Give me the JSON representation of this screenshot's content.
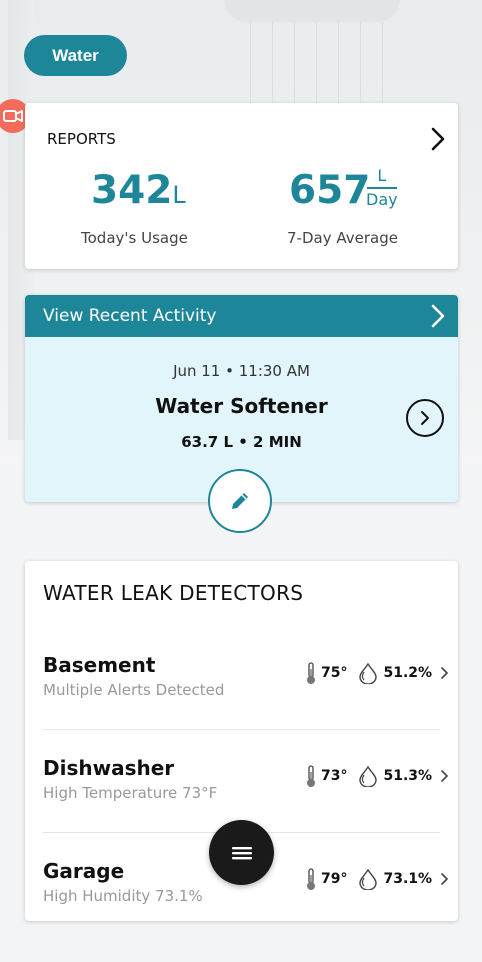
{
  "header": {
    "category_label": "Water"
  },
  "reports": {
    "title": "REPORTS",
    "today_value": "342",
    "today_unit": "L",
    "today_label": "Today's Usage",
    "avg_value": "657",
    "avg_unit_top": "L",
    "avg_unit_bottom": "Day",
    "avg_label": "7-Day Average"
  },
  "activity": {
    "header_label": "View Recent Activity",
    "date": "Jun 11 • 11:30 AM",
    "device": "Water Softener",
    "detail": "63.7 L • 2 MIN"
  },
  "leak_detectors": {
    "title": "WATER LEAK DETECTORS",
    "items": [
      {
        "name": "Basement",
        "status": "Multiple Alerts Detected",
        "temperature": "75°",
        "humidity": "51.2%"
      },
      {
        "name": "Dishwasher",
        "status": "High Temperature 73°F",
        "temperature": "73°",
        "humidity": "51.3%"
      },
      {
        "name": "Garage",
        "status": "High Humidity 73.1%",
        "temperature": "79°",
        "humidity": "73.1%"
      }
    ]
  },
  "colors": {
    "accent": "#1e8699",
    "alert": "#f26b5b",
    "activity_bg": "#e1f5fa"
  },
  "icons": {
    "camera": "video-camera-icon",
    "chevron": "chevron-right-icon",
    "edit": "pencil-icon",
    "menu": "hamburger-menu-icon",
    "thermometer": "thermometer-icon",
    "humidity": "water-drop-icon"
  }
}
